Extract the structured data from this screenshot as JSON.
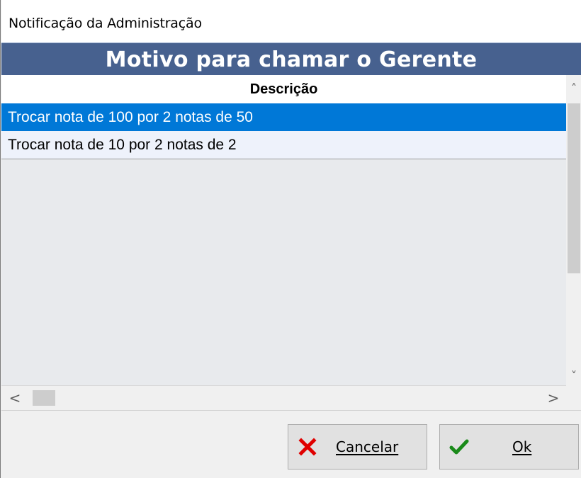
{
  "window": {
    "title": "Notificação da Administração"
  },
  "header": {
    "title": "Motivo para chamar o Gerente"
  },
  "grid": {
    "column_header": "Descrição",
    "rows": [
      {
        "description": "Trocar nota de 100 por 2 notas de 50",
        "selected": true
      },
      {
        "description": "Trocar nota de 10 por 2 notas de 2",
        "selected": false
      }
    ]
  },
  "scrollbars": {
    "up_arrow": "˄",
    "down_arrow": "˅",
    "left_arrow": "<",
    "right_arrow": ">"
  },
  "buttons": {
    "cancel": {
      "label": "Cancelar",
      "icon": "close-x-icon",
      "accent": "#e00000"
    },
    "ok": {
      "label": "Ok",
      "icon": "checkmark-icon",
      "accent": "#1a8a1a"
    }
  },
  "colors": {
    "header_band": "#47618f",
    "selection": "#0078d7"
  }
}
